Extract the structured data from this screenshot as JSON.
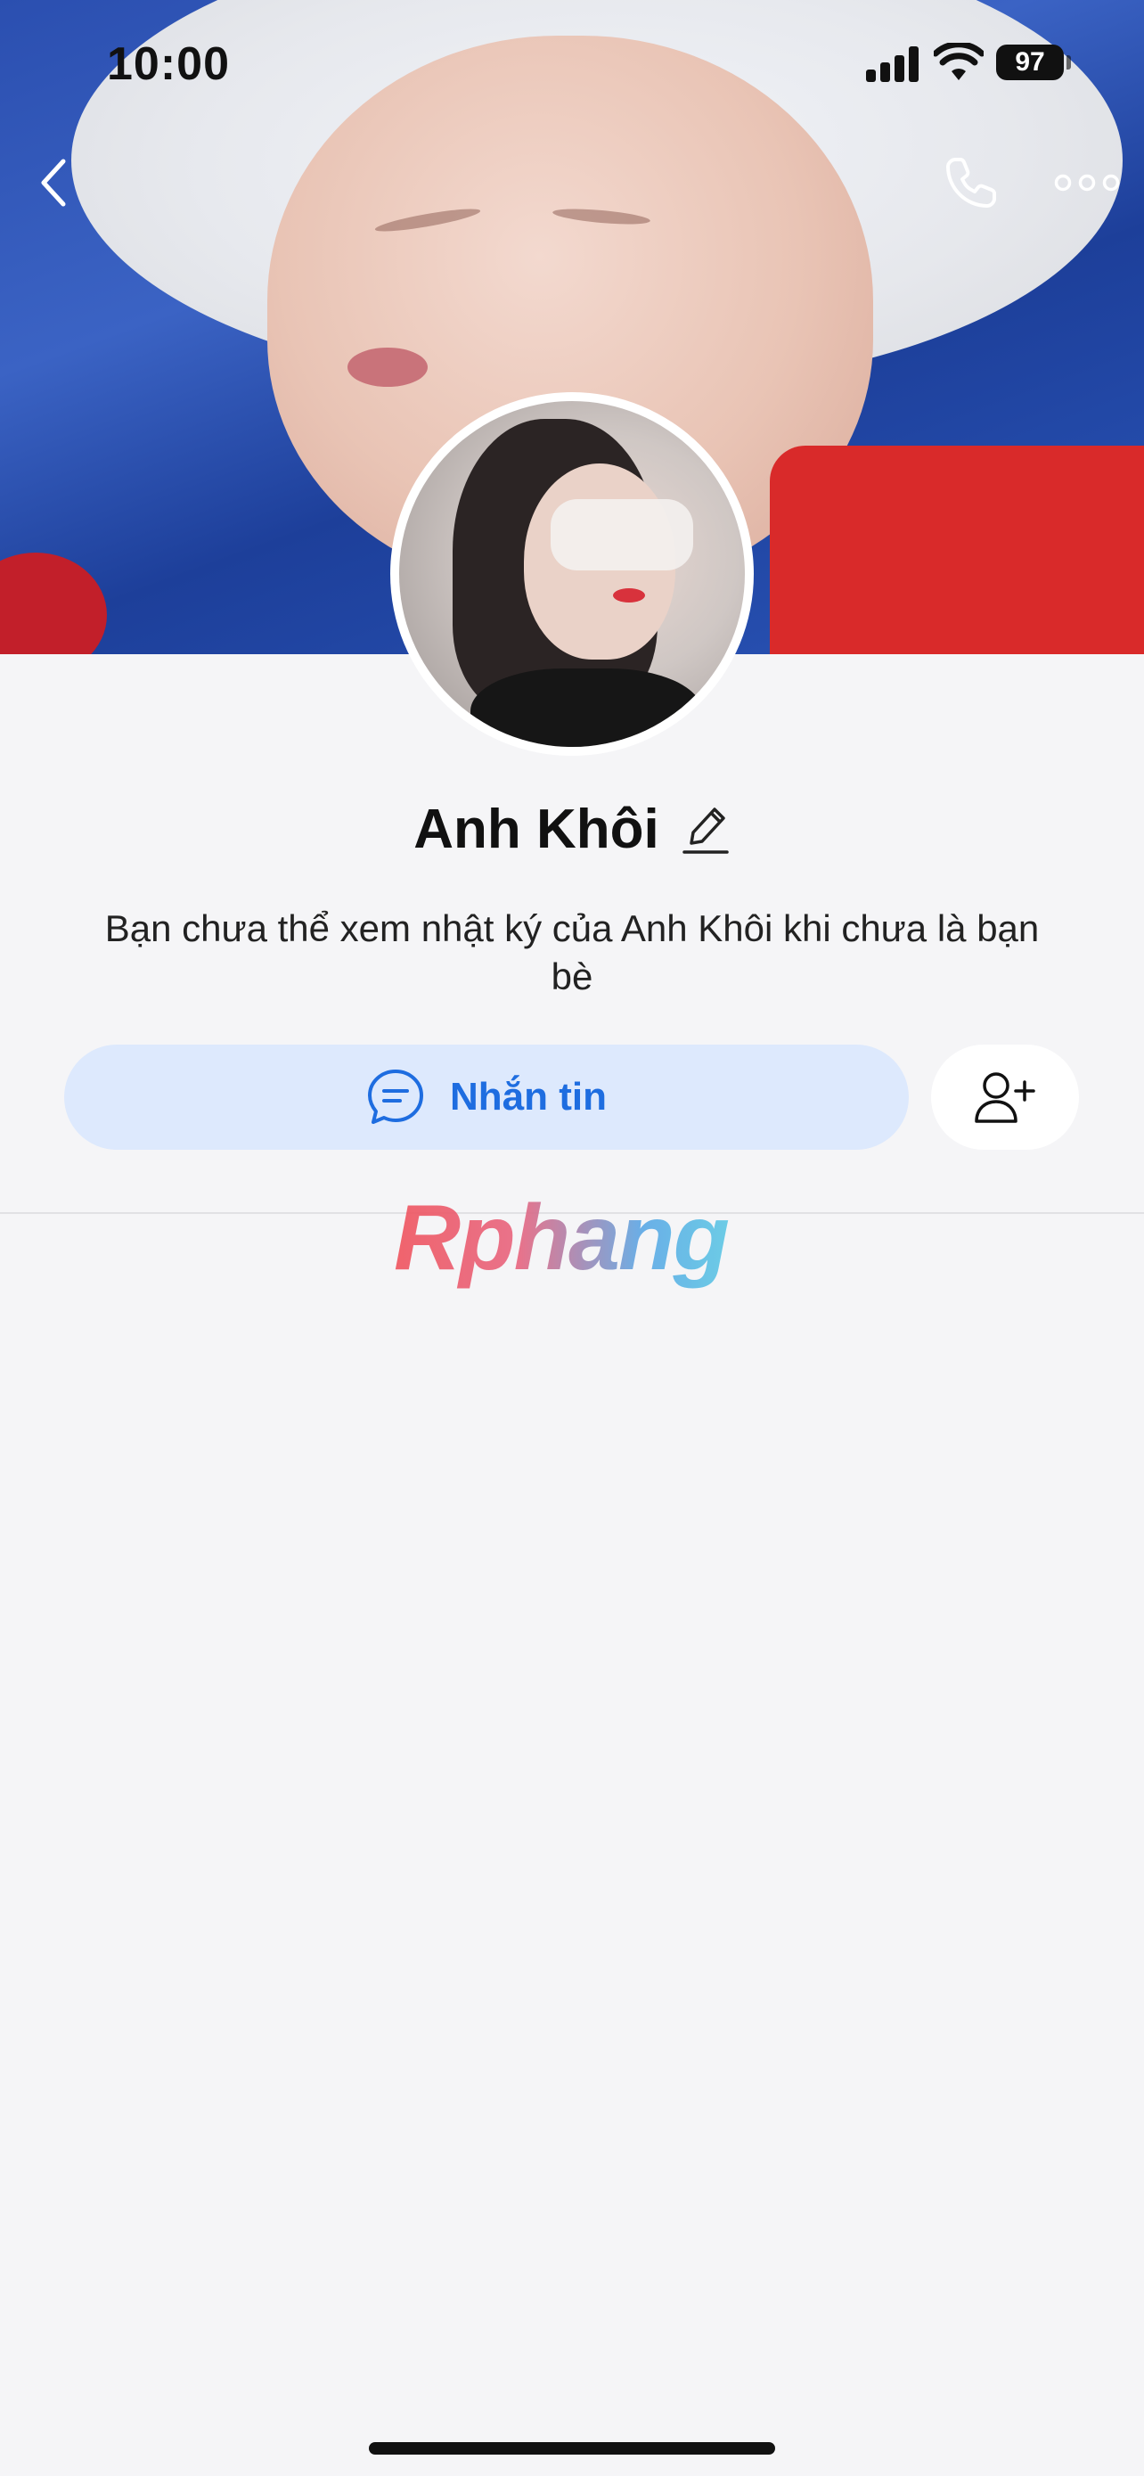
{
  "status_bar": {
    "time": "10:00",
    "battery": "97"
  },
  "header": {
    "back_icon": "chevron-left-icon",
    "call_icon": "phone-icon",
    "more_icon": "more-dots-icon"
  },
  "profile": {
    "name": "Anh Khôi",
    "edit_icon": "pencil-icon",
    "notice": "Bạn chưa thể xem nhật ký của Anh Khôi khi chưa là bạn bè"
  },
  "actions": {
    "message_label": "Nhắn tin",
    "message_icon": "chat-bubble-icon",
    "add_friend_icon": "add-friend-icon"
  },
  "watermark": {
    "text": "Rphang"
  },
  "colors": {
    "accent": "#1e6de0",
    "message_button_bg": "#dde9fd",
    "page_bg": "#f5f5f7"
  }
}
